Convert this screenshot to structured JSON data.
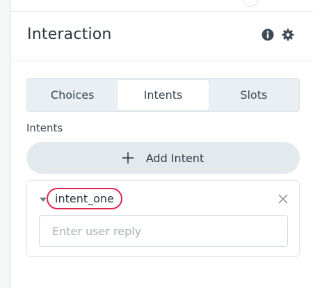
{
  "panel": {
    "title": "Interaction",
    "icons": {
      "info": "info-icon",
      "settings": "gear-icon"
    }
  },
  "tabs": [
    {
      "label": "Choices",
      "active": false
    },
    {
      "label": "Intents",
      "active": true
    },
    {
      "label": "Slots",
      "active": false
    }
  ],
  "intents_section": {
    "label": "Intents",
    "add_button_label": "Add Intent",
    "add_icon": "plus-icon"
  },
  "intent_card": {
    "name": "intent_one",
    "reply_placeholder": "Enter user reply",
    "reply_value": "",
    "highlight_color": "#e0264f"
  },
  "colors": {
    "tab_bar_bg": "#e9eff2",
    "add_button_bg": "#e3eaee",
    "text": "#2f3a43"
  }
}
